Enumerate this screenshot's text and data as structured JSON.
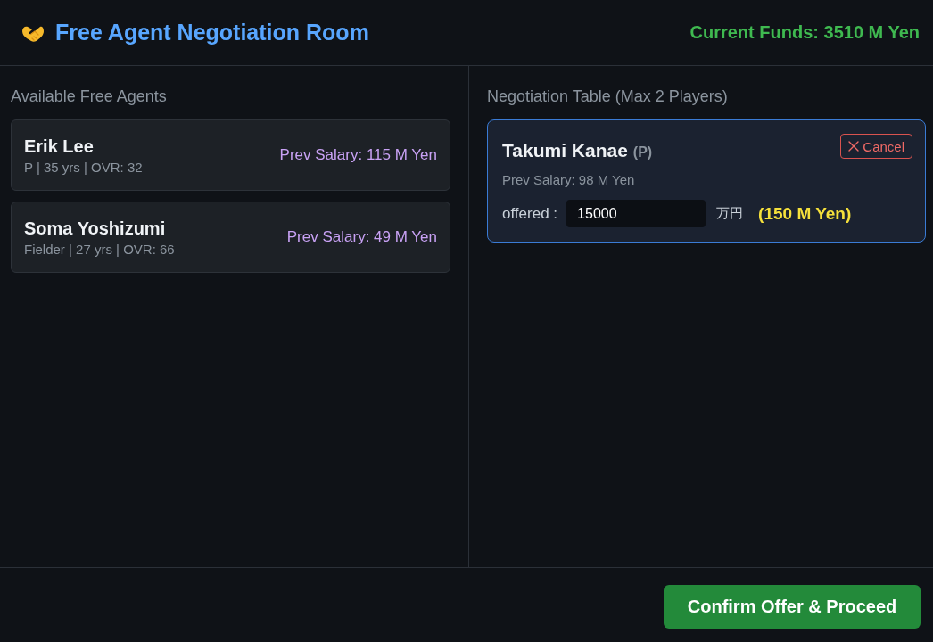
{
  "header": {
    "title": "Free Agent Negotiation Room",
    "funds": "Current Funds: 3510 M Yen"
  },
  "free_agents": {
    "heading": "Available Free Agents",
    "players": [
      {
        "name": "Erik Lee",
        "details": "P | 35 yrs | OVR: 32",
        "prev_salary": "Prev Salary: 115 M Yen"
      },
      {
        "name": "Soma Yoshizumi",
        "details": "Fielder | 27 yrs | OVR: 66",
        "prev_salary": "Prev Salary: 49 M Yen"
      }
    ]
  },
  "negotiation": {
    "heading": "Negotiation Table (Max 2 Players)",
    "players": [
      {
        "name": "Takumi Kanae",
        "position": "(P)",
        "cancel": "Cancel",
        "prev_salary": "Prev Salary: 98 M Yen",
        "offer_label": "offered :",
        "offer_value": "15000",
        "unit": "万円",
        "offer_converted": "(150 M Yen)"
      }
    ]
  },
  "confirm_button": "Confirm Offer & Proceed"
}
